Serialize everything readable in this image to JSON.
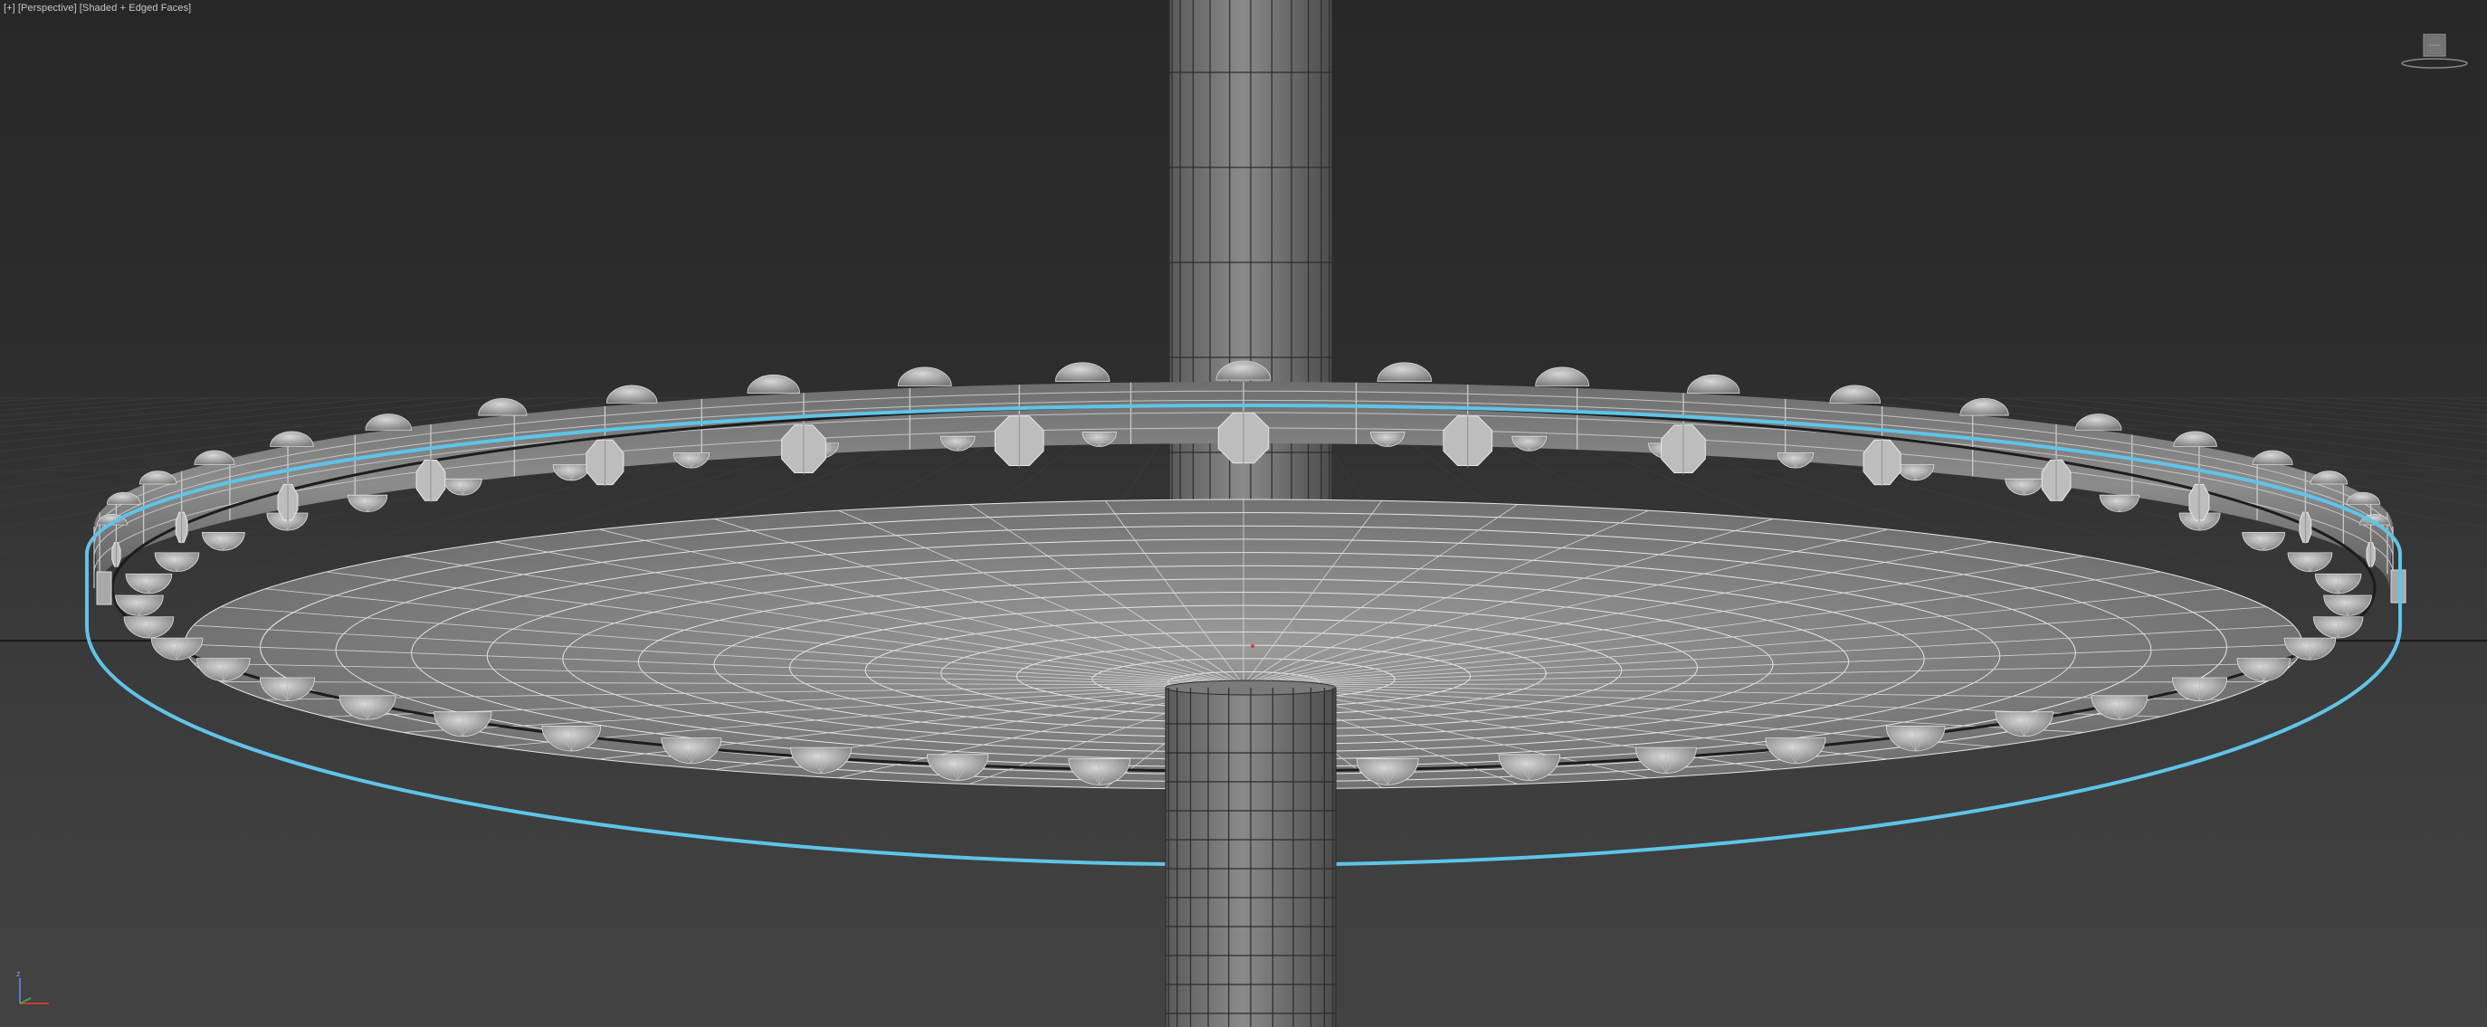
{
  "viewport": {
    "labels": [
      {
        "text": "[+]",
        "name": "viewport-menu-plus"
      },
      {
        "text": "[Perspective]",
        "name": "viewport-point-of-view-label"
      },
      {
        "text": "[Shaded + Edged Faces]",
        "name": "viewport-shading-label"
      }
    ],
    "view_type": "Perspective",
    "shading_mode": "Shaded + Edged Faces",
    "selection_color": "#5fc4e8",
    "background_color": "#2d2d2d"
  },
  "icons": {
    "viewcube": "viewcube-icon",
    "axis_tripod": "axis-tripod-icon"
  }
}
